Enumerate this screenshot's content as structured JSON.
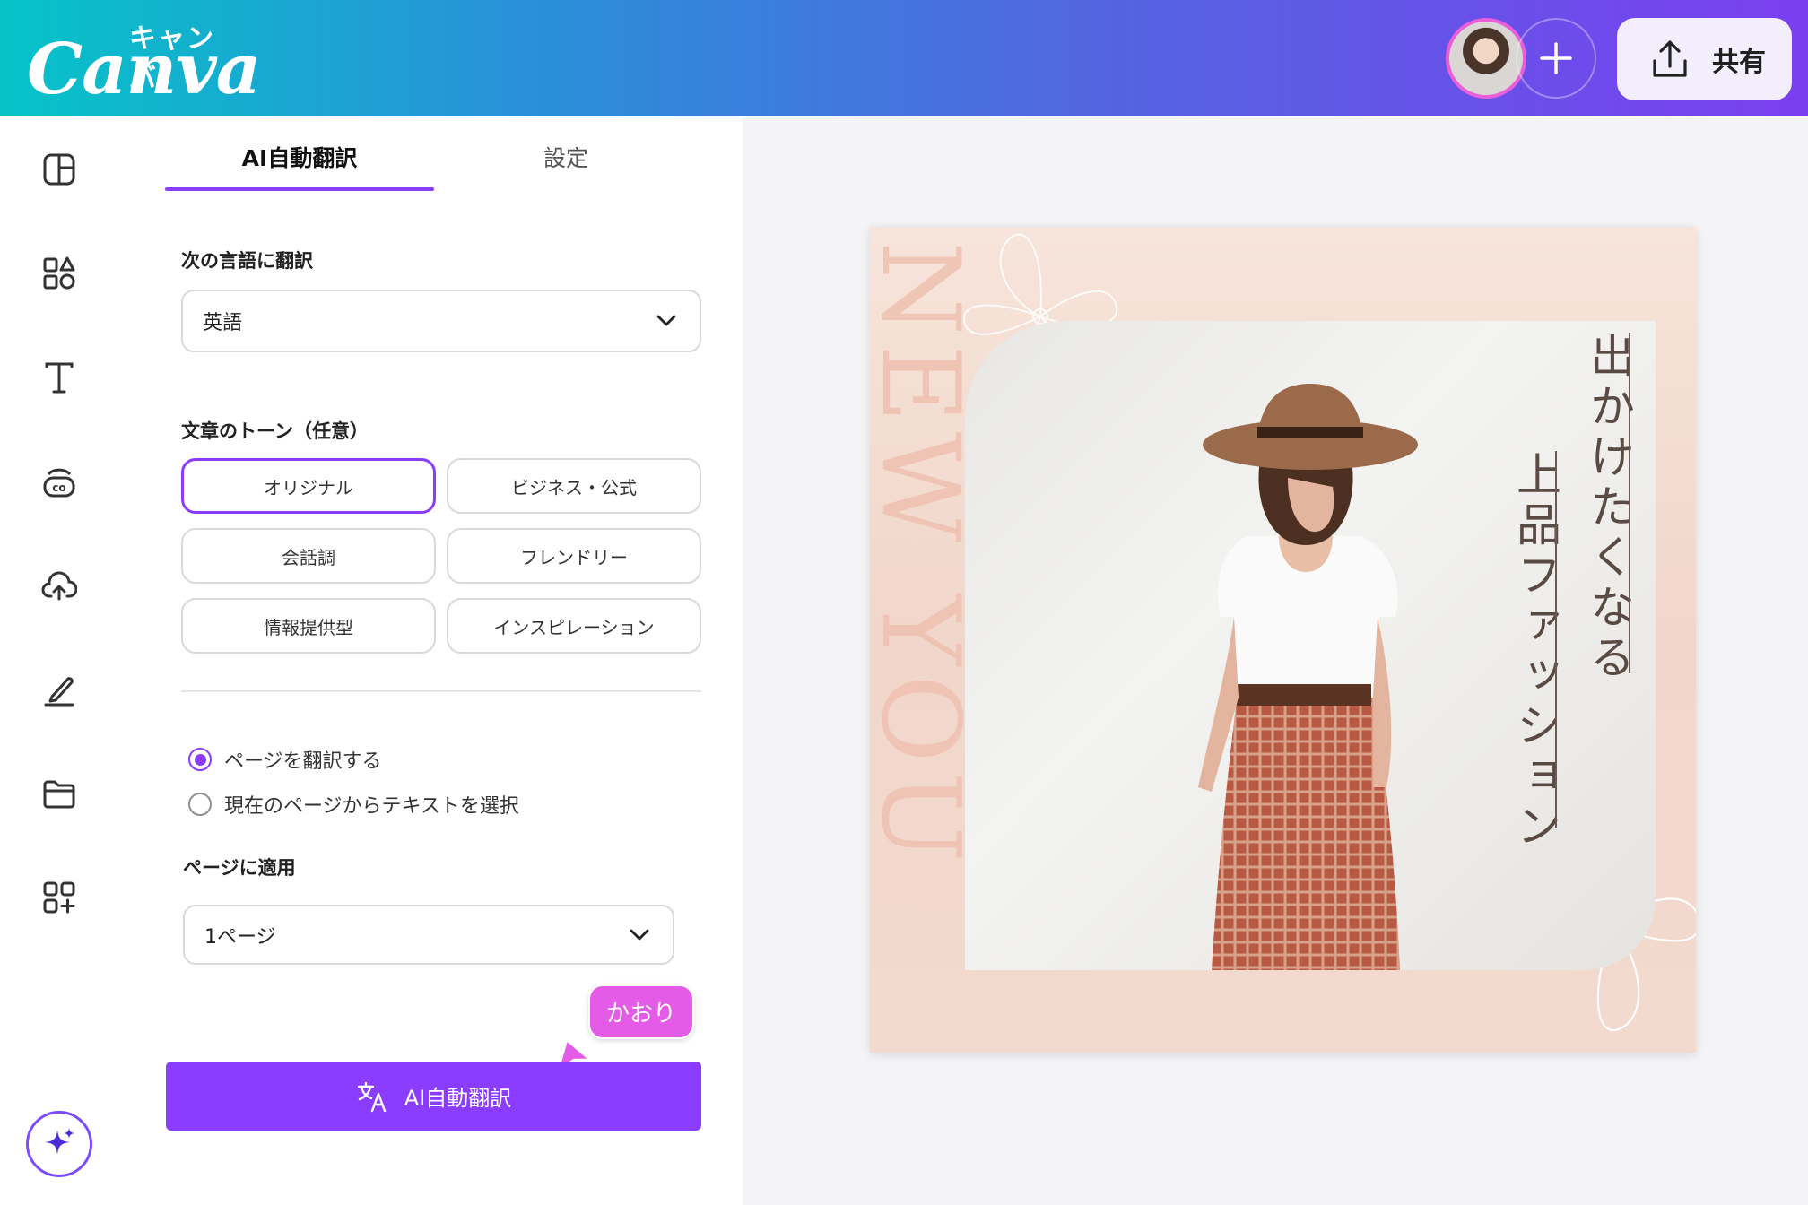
{
  "header": {
    "logo_sub": "キャンバ",
    "logo_main": "Canva",
    "share_label": "共有"
  },
  "panel": {
    "tabs": [
      {
        "label": "AI自動翻訳",
        "active": true
      },
      {
        "label": "設定",
        "active": false
      }
    ],
    "translate_to_label": "次の言語に翻訳",
    "language_value": "英語",
    "tone_label": "文章のトーン（任意）",
    "tones": [
      "オリジナル",
      "ビジネス・公式",
      "会話調",
      "フレンドリー",
      "情報提供型",
      "インスピレーション"
    ],
    "selected_tone": "オリジナル",
    "radio_options": [
      {
        "label": "ページを翻訳する",
        "checked": true
      },
      {
        "label": "現在のページからテキストを選択",
        "checked": false
      }
    ],
    "apply_label": "ページに適用",
    "page_value": "1ページ",
    "translate_button": "AI自動翻訳"
  },
  "cursor": {
    "name": "かおり",
    "color": "#e45be8"
  },
  "design": {
    "vertical_en": "NEW YOU",
    "line1": "出かけたくなる",
    "line2": "上品ファッション"
  },
  "colors": {
    "accent": "#8b3dff",
    "cursor": "#e45be8"
  }
}
